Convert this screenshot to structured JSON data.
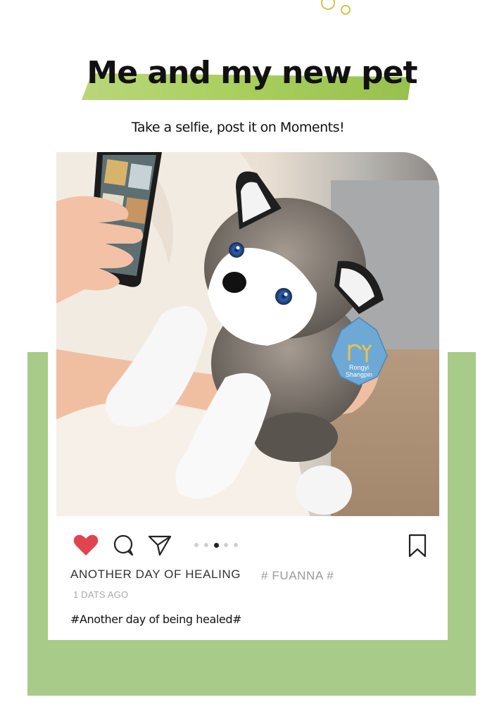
{
  "header": {
    "title": "Me and my new pet",
    "subtitle": "Take a selfie, post it on Moments!"
  },
  "photo": {
    "tag_brand_line1": "Rongyi",
    "tag_brand_line2": "Shangpin"
  },
  "actions": {
    "icons": [
      "heart-icon",
      "comment-icon",
      "send-icon",
      "bookmark-icon"
    ],
    "like_color": "#e0454f",
    "carousel_count": 5,
    "carousel_active_index": 2
  },
  "post": {
    "caption_heading": "ANOTHER DAY OF HEALING",
    "tag": "# FUANNA #",
    "timestamp": "1 DATS AGO",
    "hashtag_text": "#Another day of being healed#"
  },
  "colors": {
    "frame_green": "#a8cb8a",
    "title_highlight": "#a8cf5c",
    "deco_circles": "#d9c24a"
  }
}
